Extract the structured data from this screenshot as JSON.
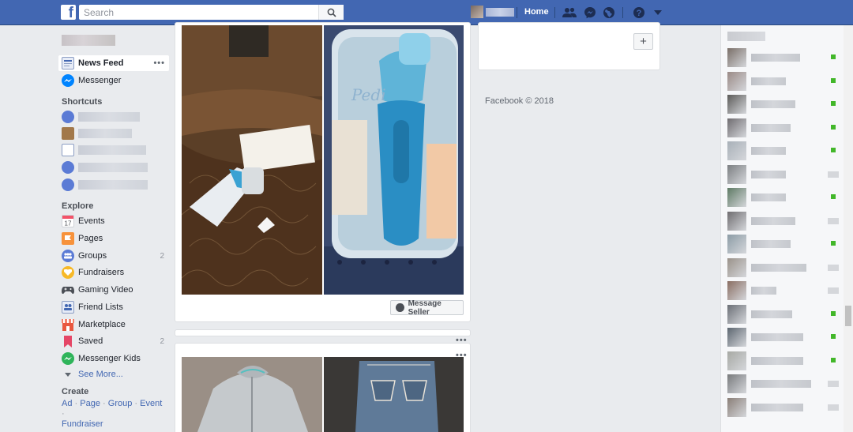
{
  "topbar": {
    "logo": "f",
    "search_placeholder": "Search",
    "home_label": "Home"
  },
  "leftnav": {
    "main_items": [
      {
        "label": "News Feed",
        "active": true
      },
      {
        "label": "Messenger"
      }
    ],
    "shortcuts_title": "Shortcuts",
    "explore_title": "Explore",
    "explore_items": [
      {
        "label": "Events",
        "icon": "calendar-icon"
      },
      {
        "label": "Pages",
        "icon": "flag-icon"
      },
      {
        "label": "Groups",
        "icon": "groups-icon",
        "count": "2"
      },
      {
        "label": "Fundraisers",
        "icon": "fundraiser-icon"
      },
      {
        "label": "Gaming Video",
        "icon": "gamepad-icon"
      },
      {
        "label": "Friend Lists",
        "icon": "friends-list-icon"
      },
      {
        "label": "Marketplace",
        "icon": "shop-icon"
      },
      {
        "label": "Saved",
        "icon": "bookmark-icon",
        "count": "2"
      },
      {
        "label": "Messenger Kids",
        "icon": "messenger-kids-icon"
      }
    ],
    "see_more": "See More...",
    "create_title": "Create",
    "create_links": [
      "Ad",
      "Page",
      "Group",
      "Event",
      "Fundraiser"
    ],
    "calendar_day": "17"
  },
  "feed": {
    "message_seller_label": "Message Seller",
    "more_glyph": "•••"
  },
  "right": {
    "plus_label": "+",
    "footer": "Facebook © 2018"
  }
}
